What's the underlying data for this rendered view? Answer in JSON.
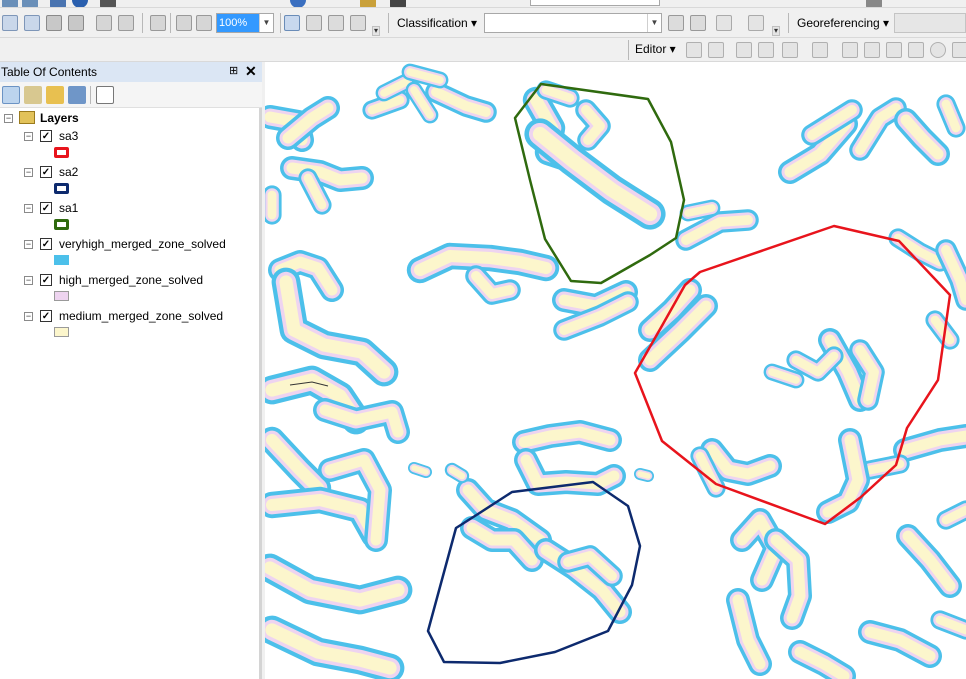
{
  "toolbar": {
    "zoom_value": "100%",
    "classification_label": "Classification ▾",
    "georeferencing_label": "Georeferencing ▾",
    "editor_label": "Editor ▾"
  },
  "toc": {
    "title": "Table Of Contents",
    "pin": "⊞",
    "close": "✕",
    "root_label": "Layers",
    "layers": [
      {
        "name": "sa3",
        "checked": "✓",
        "symbol_color": "#e8141c",
        "symbol_type": "outline"
      },
      {
        "name": "sa2",
        "checked": "✓",
        "symbol_color": "#0d2a6e",
        "symbol_type": "outline"
      },
      {
        "name": "sa1",
        "checked": "✓",
        "symbol_color": "#2f6a0e",
        "symbol_type": "outline"
      },
      {
        "name": "veryhigh_merged_zone_solved",
        "checked": "✓",
        "symbol_color": "#4cc0ea",
        "symbol_type": "fill"
      },
      {
        "name": "high_merged_zone_solved",
        "checked": "✓",
        "symbol_color": "#eed4f0",
        "symbol_type": "fill"
      },
      {
        "name": "medium_merged_zone_solved",
        "checked": "✓",
        "symbol_color": "#fcf6cc",
        "symbol_type": "fill"
      }
    ]
  },
  "colors": {
    "veryhigh": "#4cc0ea",
    "high": "#eed4f0",
    "medium": "#fcf6cc",
    "sa1": "#2f6a0e",
    "sa2": "#0d2a6e",
    "sa3": "#e8141c"
  }
}
